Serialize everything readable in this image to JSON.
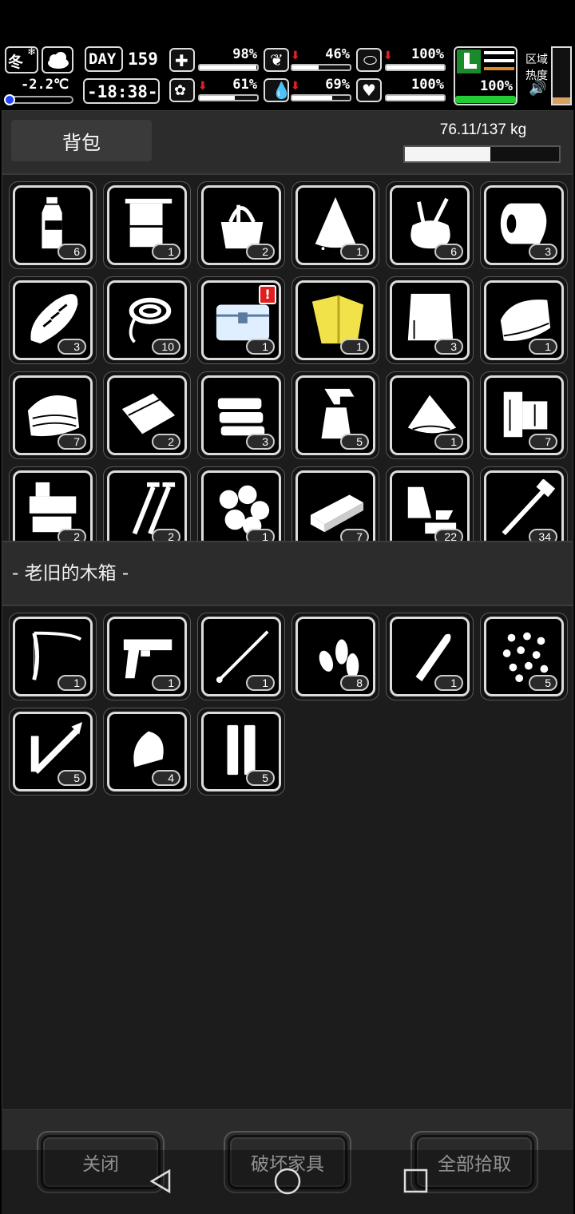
{
  "hud": {
    "season": "冬",
    "temperature": "-2.2℃",
    "day_label": "DAY",
    "day_number": "159",
    "time": "-18:38-",
    "stats": [
      {
        "name": "health",
        "icon": "medkit-icon",
        "value": "98%",
        "arrow": false,
        "fill": 0.98
      },
      {
        "name": "hunger",
        "icon": "stomach-icon",
        "value": "46%",
        "arrow": true,
        "fill": 0.46
      },
      {
        "name": "fatigue",
        "icon": "pill-icon",
        "value": "100%",
        "arrow": true,
        "fill": 1.0
      },
      {
        "name": "sanity",
        "icon": "brain-icon",
        "value": "61%",
        "arrow": true,
        "fill": 0.61
      },
      {
        "name": "thirst",
        "icon": "water-drop-icon",
        "value": "69%",
        "arrow": true,
        "fill": 0.69
      },
      {
        "name": "mood",
        "icon": "heart-icon",
        "value": "100%",
        "arrow": false,
        "fill": 1.0
      }
    ],
    "stamina_value": "100%",
    "stamina_fill": 1.0,
    "zone_label_1": "区域",
    "zone_label_2": "热度",
    "zone_heat_fill": 0.12
  },
  "backpack": {
    "tab_label": "背包",
    "weight_text": "76.11/137 kg",
    "weight_fill": 0.555,
    "items": [
      {
        "icon": "water-bottle-icon",
        "qty": "6"
      },
      {
        "icon": "towel-icon",
        "qty": "1"
      },
      {
        "icon": "tool-bag-icon",
        "qty": "2"
      },
      {
        "icon": "wet-cloth-icon",
        "qty": "1"
      },
      {
        "icon": "sack-tools-icon",
        "qty": "6"
      },
      {
        "icon": "bandage-roll-icon",
        "qty": "3"
      },
      {
        "icon": "bread-icon",
        "qty": "3"
      },
      {
        "icon": "rope-icon",
        "qty": "10"
      },
      {
        "icon": "ice-chest-icon",
        "qty": "1",
        "alert": "!"
      },
      {
        "icon": "yellow-raincoat-icon",
        "qty": "1"
      },
      {
        "icon": "fabric-sheet-icon",
        "qty": "3"
      },
      {
        "icon": "folded-cloth-icon",
        "qty": "1"
      },
      {
        "icon": "cloth-pile-icon",
        "qty": "7"
      },
      {
        "icon": "paper-sheets-icon",
        "qty": "2"
      },
      {
        "icon": "sponge-stack-icon",
        "qty": "3"
      },
      {
        "icon": "spray-bottle-icon",
        "qty": "5"
      },
      {
        "icon": "powder-pile-icon",
        "qty": "1"
      },
      {
        "icon": "wood-planks-icon",
        "qty": "7"
      },
      {
        "icon": "machine-parts-icon",
        "qty": "2"
      },
      {
        "icon": "screws-icon",
        "qty": "2"
      },
      {
        "icon": "cotton-balls-icon",
        "qty": "1"
      },
      {
        "icon": "brick-icon",
        "qty": "7"
      },
      {
        "icon": "scrap-metal-icon",
        "qty": "22"
      },
      {
        "icon": "nails-icon",
        "qty": "34"
      }
    ]
  },
  "container": {
    "title": "- 老旧的木箱 -",
    "items": [
      {
        "icon": "bow-icon",
        "qty": "1"
      },
      {
        "icon": "pistol-icon",
        "qty": "1"
      },
      {
        "icon": "rod-icon",
        "qty": "1"
      },
      {
        "icon": "bullets-icon",
        "qty": "8"
      },
      {
        "icon": "cartridge-icon",
        "qty": "1"
      },
      {
        "icon": "pellets-icon",
        "qty": "5"
      },
      {
        "icon": "rocket-launcher-icon",
        "qty": "5"
      },
      {
        "icon": "slug-icon",
        "qty": "4"
      },
      {
        "icon": "shotgun-shells-icon",
        "qty": "5"
      }
    ]
  },
  "actions": {
    "close": "关闭",
    "destroy": "破坏家具",
    "take_all": "全部拾取"
  },
  "colors": {
    "alert": "#e02020",
    "stamina": "#22cc33",
    "raincoat": "#f2e24a"
  }
}
